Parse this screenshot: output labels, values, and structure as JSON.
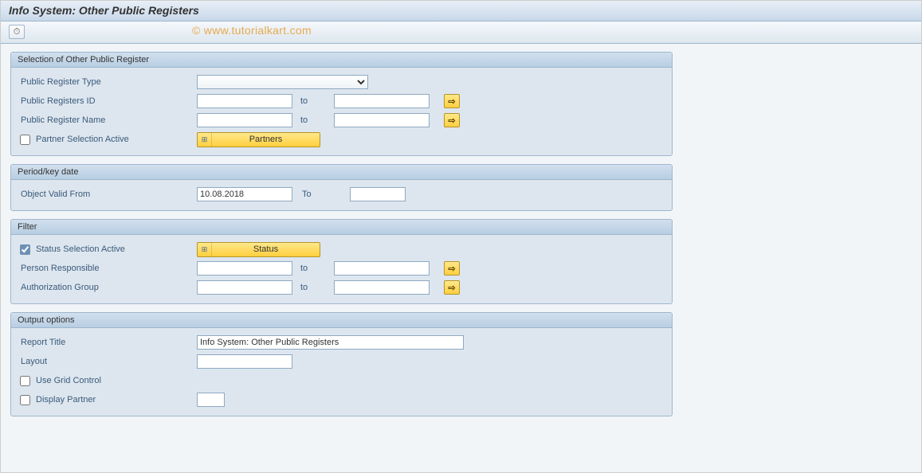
{
  "title": "Info System: Other Public Registers",
  "watermark": "© www.tutorialkart.com",
  "toolbar": {
    "execute_icon": "⏱"
  },
  "groups": {
    "selection": {
      "title": "Selection of Other Public Register",
      "reg_type_label": "Public Register Type",
      "reg_type_value": "",
      "reg_id_label": "Public Registers ID",
      "reg_id_from": "",
      "reg_id_to": "",
      "reg_name_label": "Public Register Name",
      "reg_name_from": "",
      "reg_name_to": "",
      "partner_sel_label": "Partner Selection Active",
      "partner_sel_checked": false,
      "partners_btn": "Partners",
      "to_label": "to"
    },
    "period": {
      "title": "Period/key date",
      "valid_from_label": "Object Valid From",
      "valid_from_value": "10.08.2018",
      "to_label": "To",
      "valid_to_value": ""
    },
    "filter": {
      "title": "Filter",
      "status_sel_label": "Status Selection Active",
      "status_sel_checked": true,
      "status_btn": "Status",
      "person_label": "Person Responsible",
      "person_from": "",
      "person_to": "",
      "auth_label": "Authorization Group",
      "auth_from": "",
      "auth_to": "",
      "to_label": "to"
    },
    "output": {
      "title": "Output options",
      "report_title_label": "Report Title",
      "report_title_value": "Info System: Other Public Registers",
      "layout_label": "Layout",
      "layout_value": "",
      "grid_label": "Use Grid Control",
      "grid_checked": false,
      "display_partner_label": "Display Partner",
      "display_partner_checked": false,
      "display_partner_value": ""
    }
  }
}
